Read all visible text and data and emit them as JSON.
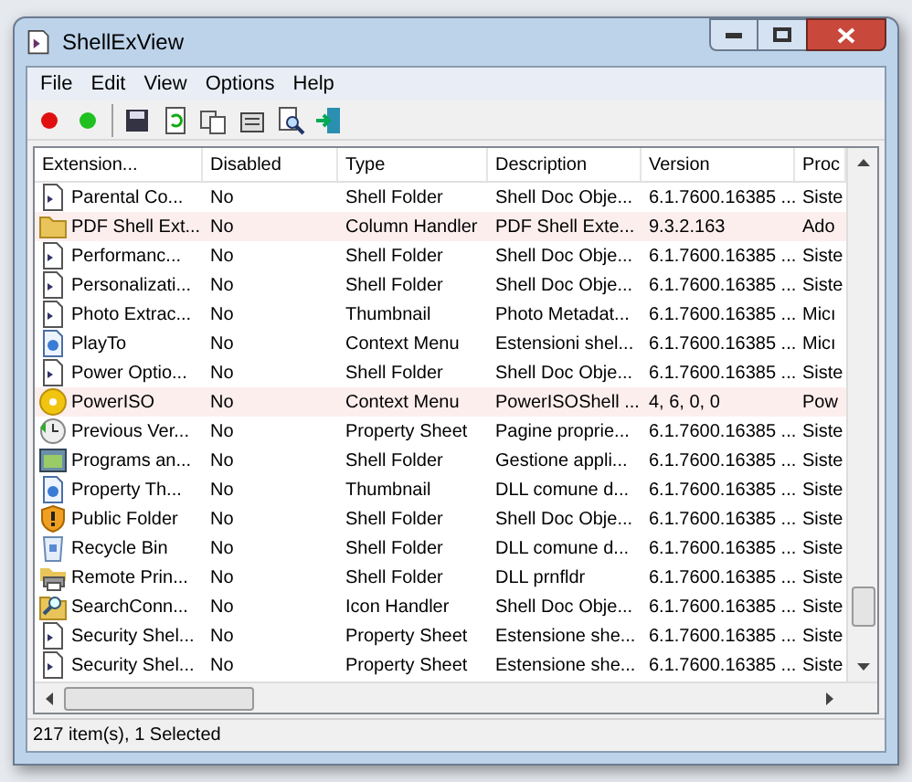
{
  "window": {
    "title": "ShellExView"
  },
  "menu": [
    "File",
    "Edit",
    "View",
    "Options",
    "Help"
  ],
  "table": {
    "columns": [
      "Extension...",
      "Disabled",
      "Type",
      "Description",
      "Version",
      "Proc"
    ],
    "rows": [
      {
        "kind": "doc",
        "highlighted": false,
        "cells": [
          "Parental Co...",
          "No",
          "Shell Folder",
          "Shell Doc Obje...",
          "6.1.7600.16385 ...",
          "Siste"
        ]
      },
      {
        "kind": "folder",
        "highlighted": true,
        "cells": [
          "PDF Shell Ext...",
          "No",
          "Column Handler",
          "PDF Shell Exte...",
          "9.3.2.163",
          "Ado"
        ]
      },
      {
        "kind": "doc",
        "highlighted": false,
        "cells": [
          "Performanc...",
          "No",
          "Shell Folder",
          "Shell Doc Obje...",
          "6.1.7600.16385 ...",
          "Siste"
        ]
      },
      {
        "kind": "doc",
        "highlighted": false,
        "cells": [
          "Personalizati...",
          "No",
          "Shell Folder",
          "Shell Doc Obje...",
          "6.1.7600.16385 ...",
          "Siste"
        ]
      },
      {
        "kind": "doc",
        "highlighted": false,
        "cells": [
          "Photo Extrac...",
          "No",
          "Thumbnail",
          "Photo Metadat...",
          "6.1.7600.16385 ...",
          "Micı"
        ]
      },
      {
        "kind": "media",
        "highlighted": false,
        "cells": [
          "PlayTo",
          "No",
          "Context Menu",
          "Estensioni shel...",
          "6.1.7600.16385 ...",
          "Micı"
        ]
      },
      {
        "kind": "doc",
        "highlighted": false,
        "cells": [
          "Power Optio...",
          "No",
          "Shell Folder",
          "Shell Doc Obje...",
          "6.1.7600.16385 ...",
          "Siste"
        ]
      },
      {
        "kind": "disc",
        "highlighted": true,
        "cells": [
          "PowerISO",
          "No",
          "Context Menu",
          "PowerISOShell ...",
          "4, 6, 0, 0",
          "Pow"
        ]
      },
      {
        "kind": "clock",
        "highlighted": false,
        "cells": [
          "Previous Ver...",
          "No",
          "Property Sheet",
          "Pagine proprie...",
          "6.1.7600.16385 ...",
          "Siste"
        ]
      },
      {
        "kind": "programs",
        "highlighted": false,
        "cells": [
          "Programs an...",
          "No",
          "Shell Folder",
          "Gestione appli...",
          "6.1.7600.16385 ...",
          "Siste"
        ]
      },
      {
        "kind": "media",
        "highlighted": false,
        "cells": [
          "Property Th...",
          "No",
          "Thumbnail",
          "DLL comune d...",
          "6.1.7600.16385 ...",
          "Siste"
        ]
      },
      {
        "kind": "shield",
        "highlighted": false,
        "cells": [
          "Public Folder",
          "No",
          "Shell Folder",
          "Shell Doc Obje...",
          "6.1.7600.16385 ...",
          "Siste"
        ]
      },
      {
        "kind": "bin",
        "highlighted": false,
        "cells": [
          "Recycle Bin",
          "No",
          "Shell Folder",
          "DLL comune d...",
          "6.1.7600.16385 ...",
          "Siste"
        ]
      },
      {
        "kind": "printer",
        "highlighted": false,
        "cells": [
          "Remote Prin...",
          "No",
          "Shell Folder",
          "DLL prnfldr",
          "6.1.7600.16385 ...",
          "Siste"
        ]
      },
      {
        "kind": "search",
        "highlighted": false,
        "cells": [
          "SearchConn...",
          "No",
          "Icon Handler",
          "Shell Doc Obje...",
          "6.1.7600.16385 ...",
          "Siste"
        ]
      },
      {
        "kind": "doc",
        "highlighted": false,
        "cells": [
          "Security Shel...",
          "No",
          "Property Sheet",
          "Estensione she...",
          "6.1.7600.16385 ...",
          "Siste"
        ]
      },
      {
        "kind": "doc",
        "highlighted": false,
        "cells": [
          "Security Shel...",
          "No",
          "Property Sheet",
          "Estensione she...",
          "6.1.7600.16385 ...",
          "Siste"
        ]
      }
    ]
  },
  "status_bar": "217 item(s), 1 Selected"
}
